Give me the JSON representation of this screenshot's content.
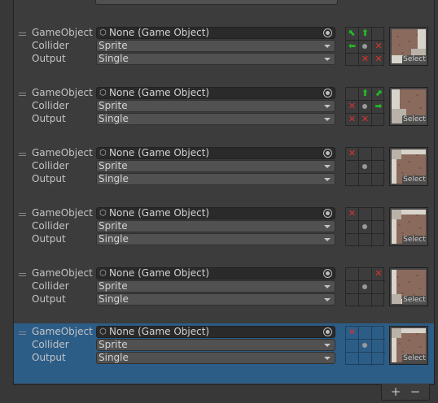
{
  "labels": {
    "gameobject": "GameObject",
    "collider": "Collider",
    "output": "Output"
  },
  "select_label": "Select",
  "footer": {
    "add": "+",
    "remove": "−"
  },
  "rules": [
    {
      "gameobject": "None (Game Object)",
      "collider": "Sprite",
      "output": "Single",
      "selected": false,
      "neighbors": [
        "arrow-up-left",
        "arrow-up",
        "",
        "arrow-left",
        "center",
        "x",
        "",
        "x",
        "x"
      ],
      "sprite": "inner-corner-bottom-right"
    },
    {
      "gameobject": "None (Game Object)",
      "collider": "Sprite",
      "output": "Single",
      "selected": false,
      "neighbors": [
        "",
        "arrow-up",
        "arrow-up-right",
        "x",
        "center",
        "arrow-right",
        "x",
        "x",
        ""
      ],
      "sprite": "inner-corner-bottom-left"
    },
    {
      "gameobject": "None (Game Object)",
      "collider": "Sprite",
      "output": "Single",
      "selected": false,
      "neighbors": [
        "x",
        "",
        "",
        "",
        "center",
        "",
        "",
        "",
        ""
      ],
      "sprite": "corner-top-left"
    },
    {
      "gameobject": "None (Game Object)",
      "collider": "Sprite",
      "output": "Single",
      "selected": false,
      "neighbors": [
        "x",
        "",
        "",
        "",
        "center",
        "",
        "",
        "",
        ""
      ],
      "sprite": "corner-top-left"
    },
    {
      "gameobject": "None (Game Object)",
      "collider": "Sprite",
      "output": "Single",
      "selected": false,
      "neighbors": [
        "",
        "",
        "x",
        "",
        "center",
        "",
        "",
        "",
        ""
      ],
      "sprite": "corner-bottom-left"
    },
    {
      "gameobject": "None (Game Object)",
      "collider": "Sprite",
      "output": "Single",
      "selected": true,
      "neighbors": [
        "x",
        "",
        "",
        "",
        "center",
        "",
        "",
        "",
        ""
      ],
      "sprite": "corner-top-left"
    }
  ],
  "colors": {
    "panel": "#3c3c3c",
    "selected_row": "#2c5d87",
    "x_mark": "#e03030",
    "arrow": "#25b825"
  }
}
